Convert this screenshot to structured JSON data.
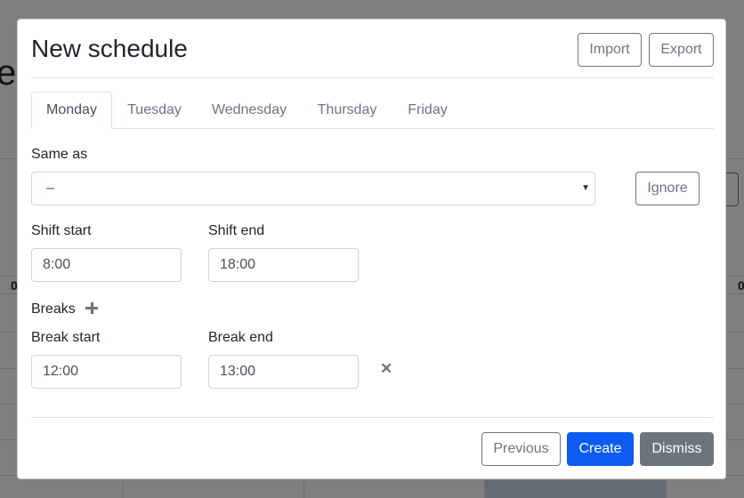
{
  "background": {
    "title_fragment": "e",
    "left_number": "0",
    "right_number": "0"
  },
  "modal": {
    "title": "New schedule",
    "import_label": "Import",
    "export_label": "Export",
    "tabs": [
      {
        "label": "Monday",
        "active": true
      },
      {
        "label": "Tuesday",
        "active": false
      },
      {
        "label": "Wednesday",
        "active": false
      },
      {
        "label": "Thursday",
        "active": false
      },
      {
        "label": "Friday",
        "active": false
      }
    ],
    "same_as": {
      "label": "Same as",
      "selected": "–",
      "ignore_label": "Ignore"
    },
    "shift": {
      "start_label": "Shift start",
      "start_value": "8:00",
      "end_label": "Shift end",
      "end_value": "18:00"
    },
    "breaks": {
      "label": "Breaks",
      "start_label": "Break start",
      "start_value": "12:00",
      "end_label": "Break end",
      "end_value": "13:00"
    },
    "footer": {
      "previous_label": "Previous",
      "create_label": "Create",
      "dismiss_label": "Dismiss"
    }
  },
  "colors": {
    "primary": "#0d5bf0",
    "secondary": "#6c757d",
    "overlay": "rgba(0,0,0,0.5)"
  },
  "icons": {
    "add_break": "plus-icon",
    "remove_break": "close-icon",
    "select_arrow": "chevron-down-icon"
  }
}
